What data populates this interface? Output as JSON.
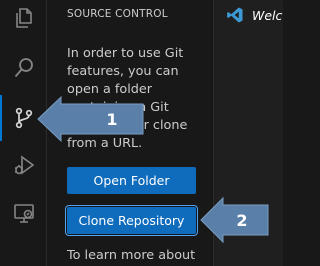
{
  "sidebar": {
    "title": "SOURCE CONTROL",
    "message_lines": [
      "In order to use Git",
      "features, you can",
      "open a folder",
      "containing a Git",
      "repository or clone",
      "from a URL."
    ],
    "open_folder_label": "Open Folder",
    "clone_repository_label": "Clone Repository",
    "learn_more": "To learn more about"
  },
  "editor": {
    "tab_title": "Welcome"
  },
  "callouts": {
    "first": "1",
    "second": "2"
  },
  "activity_bar": {
    "items": [
      "explorer-icon",
      "search-icon",
      "source-control-icon",
      "run-and-debug-icon",
      "remote-explorer-icon"
    ],
    "active": "source-control-icon"
  },
  "colors": {
    "accent": "#0078d4",
    "button": "#0f6cbd",
    "callout": "#5a7fa8",
    "vscode_logo": "#3c99d4"
  }
}
